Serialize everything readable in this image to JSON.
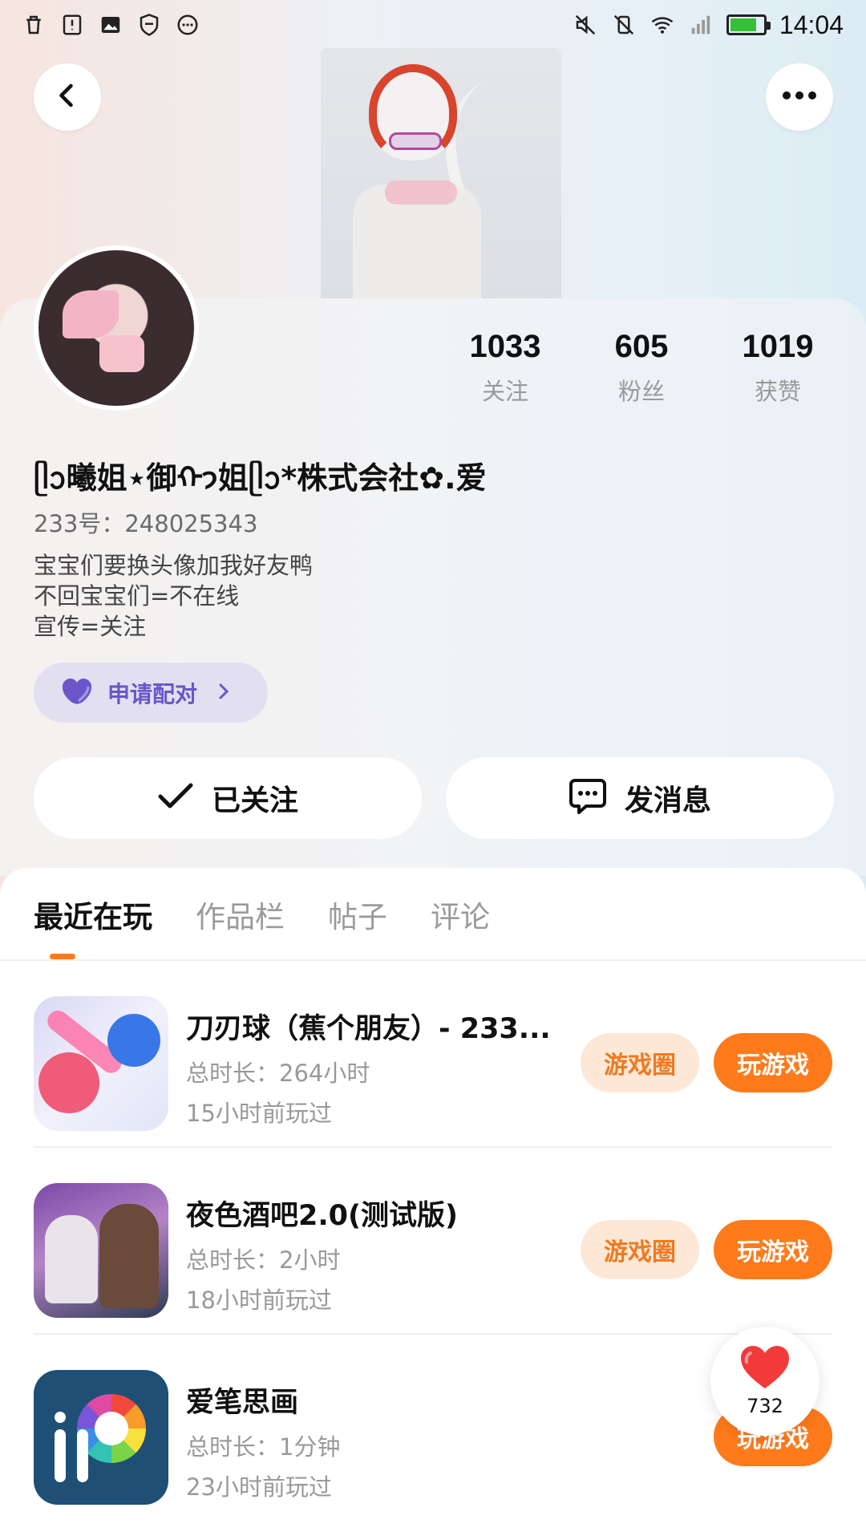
{
  "status_bar": {
    "time": "14:04",
    "battery_level": 0.8,
    "left_icons": [
      "trash-icon",
      "alert-icon",
      "image-icon",
      "shield-icon",
      "more-circle-icon"
    ],
    "right_icons": [
      "mute-icon",
      "vibrate-off-icon",
      "wifi-icon",
      "signal-icon",
      "battery-icon"
    ]
  },
  "header": {
    "back_icon": "chevron-left-icon",
    "more_icon": "more-horizontal-icon"
  },
  "profile": {
    "stats": [
      {
        "value": "1033",
        "label": "关注"
      },
      {
        "value": "605",
        "label": "粉丝"
      },
      {
        "value": "1019",
        "label": "获赞"
      }
    ],
    "nickname": "ᥫᩣ曦姐⋆御ᡣ𐭩姐ᥫᩣ*株式会社✿.爱",
    "account_id": "233号：248025343",
    "bio_lines": [
      "宝宝们要换头像加我好友鸭",
      "不回宝宝们=不在线",
      "宣传=关注"
    ],
    "pair_button": "申请配对",
    "follow_button": "已关注",
    "message_button": "发消息",
    "colors": {
      "accent": "#ff7a1a",
      "pair": "#6a56c9"
    }
  },
  "tabs": [
    {
      "label": "最近在玩",
      "active": true
    },
    {
      "label": "作品栏",
      "active": false
    },
    {
      "label": "帖子",
      "active": false
    },
    {
      "label": "评论",
      "active": false
    }
  ],
  "games": [
    {
      "title": "刀刃球（蕉个朋友）- 233...",
      "duration": "总时长：264小时",
      "last_played": "15小时前玩过",
      "circle_button": "游戏圈",
      "play_button": "玩游戏"
    },
    {
      "title": "夜色酒吧2.0(测试版)",
      "duration": "总时长：2小时",
      "last_played": "18小时前玩过",
      "circle_button": "游戏圈",
      "play_button": "玩游戏"
    },
    {
      "title": "爱笔思画",
      "duration": "总时长：1分钟",
      "last_played": "23小时前玩过",
      "play_button": "玩游戏"
    }
  ],
  "floating_like": {
    "count": "732",
    "icon": "heart-icon"
  }
}
